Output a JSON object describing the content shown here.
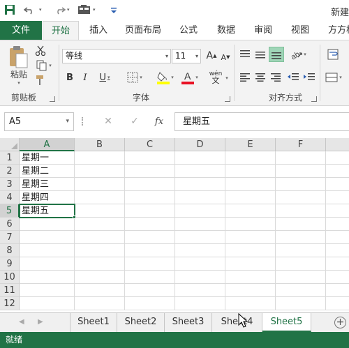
{
  "title_bar": {
    "title": "新建",
    "accent": "#217346"
  },
  "qat": {
    "icons": [
      "save-icon",
      "undo-icon",
      "redo-icon",
      "form-icon",
      "customize-icon"
    ]
  },
  "tabs": [
    {
      "label": "文件"
    },
    {
      "label": "开始"
    },
    {
      "label": "插入"
    },
    {
      "label": "页面布局"
    },
    {
      "label": "公式"
    },
    {
      "label": "数据"
    },
    {
      "label": "审阅"
    },
    {
      "label": "视图"
    },
    {
      "label": "方方格"
    }
  ],
  "ribbon": {
    "clipboard": {
      "paste_label": "粘贴",
      "group_label": "剪贴板"
    },
    "font": {
      "name": "等线",
      "size": "11",
      "wen_label": "wén",
      "group_label": "字体"
    },
    "alignment": {
      "group_label": "对齐方式"
    },
    "colors": {
      "highlight": "#ffff00",
      "font_color": "#e81123"
    }
  },
  "formula_bar": {
    "name_box": "A5",
    "formula": "星期五",
    "fx": "fx"
  },
  "grid": {
    "columns": [
      "A",
      "B",
      "C",
      "D",
      "E",
      "F"
    ],
    "rows": [
      "1",
      "2",
      "3",
      "4",
      "5",
      "6",
      "7",
      "8",
      "9",
      "10",
      "11",
      "12"
    ],
    "cells": {
      "A1": "星期一",
      "A2": "星期二",
      "A3": "星期三",
      "A4": "星期四",
      "A5": "星期五"
    },
    "active_cell": "A5"
  },
  "sheets": [
    "Sheet1",
    "Sheet2",
    "Sheet3",
    "Sheet4",
    "Sheet5"
  ],
  "active_sheet": "Sheet5",
  "status": "就绪"
}
